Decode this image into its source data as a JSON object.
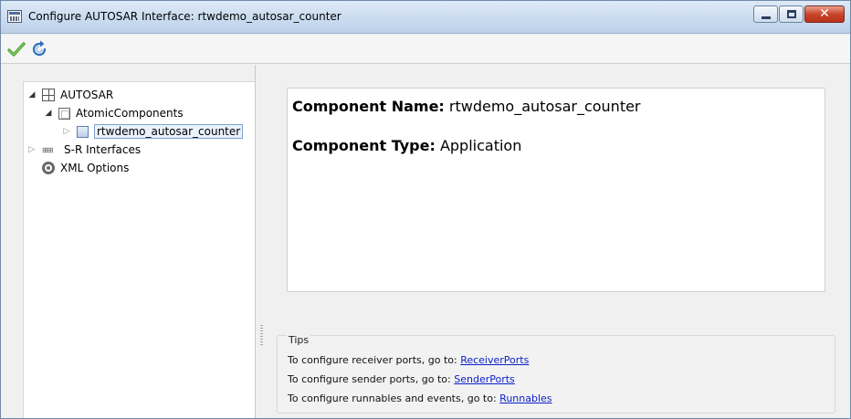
{
  "window": {
    "title": "Configure AUTOSAR Interface: rtwdemo_autosar_counter",
    "close_glyph": "✕"
  },
  "toolbar": {
    "apply_icon": "checkmark-icon",
    "refresh_icon": "refresh-icon"
  },
  "tree": {
    "root": {
      "label": "AUTOSAR",
      "expanded": true,
      "icon": "grid-icon"
    },
    "atomic": {
      "label": "AtomicComponents",
      "expanded": true,
      "icon": "box-icon"
    },
    "component": {
      "label": "rtwdemo_autosar_counter",
      "selected": true,
      "icon": "component-icon"
    },
    "sr": {
      "label": "S-R Interfaces",
      "expanded": false,
      "icon": "interfaces-icon"
    },
    "xml": {
      "label": "XML Options",
      "icon": "gear-icon"
    }
  },
  "details": {
    "name_label": "Component Name:",
    "name_value": "rtwdemo_autosar_counter",
    "type_label": "Component Type:",
    "type_value": "Application"
  },
  "tips": {
    "title": "Tips",
    "items": [
      {
        "text": "To configure receiver ports, go to:",
        "link": "ReceiverPorts"
      },
      {
        "text": "To configure  sender ports, go to:",
        "link": "SenderPorts"
      },
      {
        "text": "To configure runnables and events, go to:",
        "link": "Runnables"
      }
    ]
  },
  "colors": {
    "accent": "#0a1ec8",
    "titlebar": "#c9dbef",
    "close_button": "#c9452b"
  }
}
